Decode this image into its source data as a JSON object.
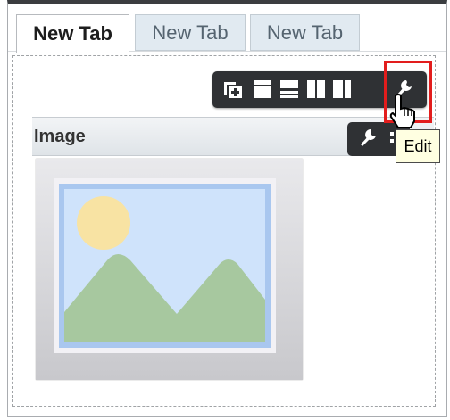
{
  "tabs": [
    {
      "label": "New Tab",
      "active": true
    },
    {
      "label": "New Tab",
      "active": false
    },
    {
      "label": "New Tab",
      "active": false
    }
  ],
  "layout_toolbar": {
    "icons": [
      "add-portlet-icon",
      "one-column-layout-icon",
      "two-row-layout-icon",
      "two-column-layout-icon",
      "three-column-layout-icon",
      "wrench-icon"
    ],
    "selected": "wrench-icon"
  },
  "portlet": {
    "title": "Image",
    "toolbar_icons": [
      "wrench-icon",
      "more-icon"
    ]
  },
  "tooltip": {
    "text": "Edit"
  },
  "colors": {
    "highlight": "#e21d1d",
    "toolbar": "#2f3134",
    "tab_inactive": "#e1eaf1",
    "tooltip_bg": "#ffffe1"
  }
}
